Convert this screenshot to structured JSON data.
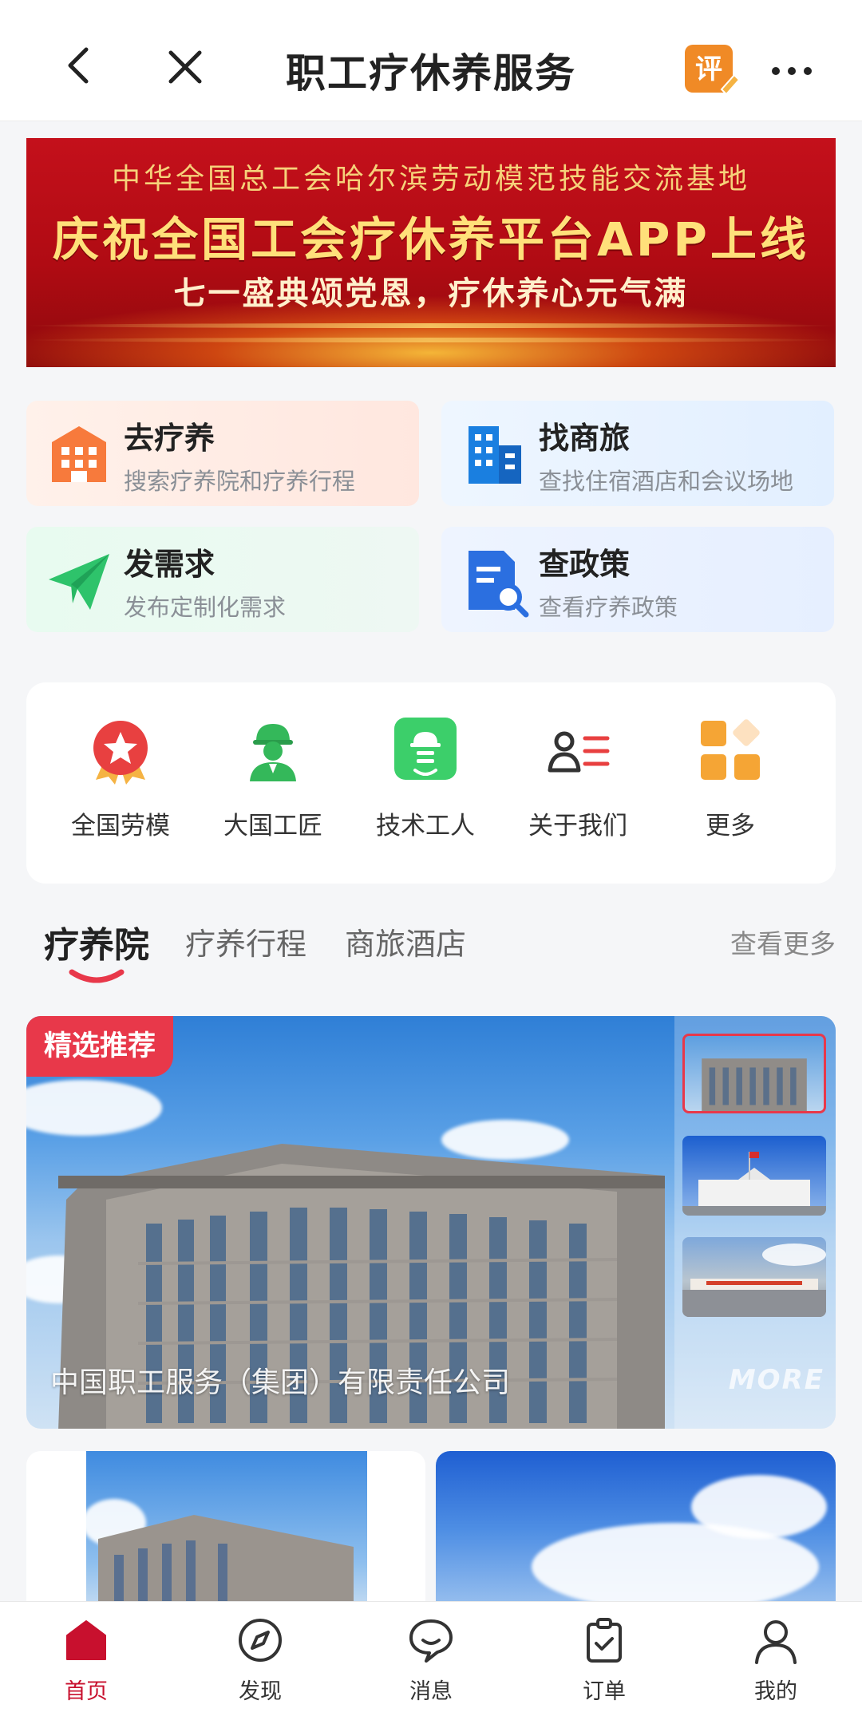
{
  "header": {
    "title": "职工疗休养服务",
    "review_badge": "评"
  },
  "banner": {
    "line1": "中华全国总工会哈尔滨劳动模范技能交流基地",
    "line2": "庆祝全国工会疗休养平台APP上线",
    "line3": "七一盛典颂党恩，疗休养心元气满"
  },
  "features": [
    {
      "title": "去疗养",
      "subtitle": "搜索疗养院和疗养行程"
    },
    {
      "title": "找商旅",
      "subtitle": "查找住宿酒店和会议场地"
    },
    {
      "title": "发需求",
      "subtitle": "发布定制化需求"
    },
    {
      "title": "查政策",
      "subtitle": "查看疗养政策"
    }
  ],
  "quick_links": [
    {
      "label": "全国劳模"
    },
    {
      "label": "大国工匠"
    },
    {
      "label": "技术工人"
    },
    {
      "label": "关于我们"
    },
    {
      "label": "更多"
    }
  ],
  "tabs": {
    "items": [
      "疗养院",
      "疗养行程",
      "商旅酒店"
    ],
    "active": "疗养院",
    "see_more": "查看更多"
  },
  "featured": {
    "badge": "精选推荐",
    "caption": "中国职工服务（集团）有限责任公司",
    "more_mark": "MORE"
  },
  "bottom_nav": [
    {
      "label": "首页",
      "active": true
    },
    {
      "label": "发现"
    },
    {
      "label": "消息"
    },
    {
      "label": "订单"
    },
    {
      "label": "我的"
    }
  ],
  "colors": {
    "accent": "#c8102e",
    "badge": "#e8384a",
    "banner_red": "#c4101b"
  }
}
